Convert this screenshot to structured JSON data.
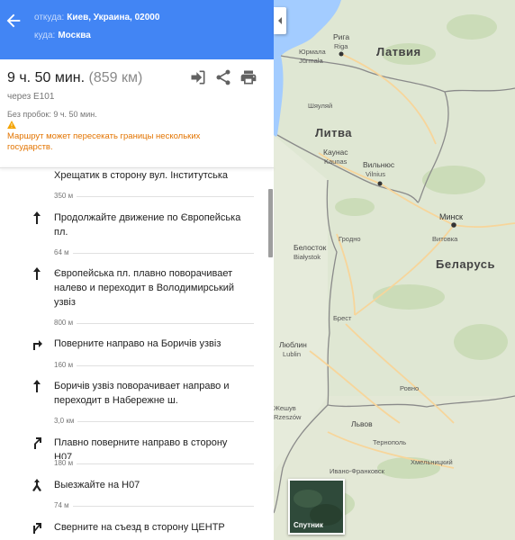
{
  "header": {
    "from_label": "откуда:",
    "from_value": "Киев, Украина, 02000",
    "to_label": "куда:",
    "to_value": "Москва"
  },
  "summary": {
    "duration": "9 ч. 50 мин.",
    "distance": "(859 км)",
    "via": "через E101",
    "no_traffic": "Без пробок: 9 ч. 50 мин.",
    "warning": "Маршрут может пересекать границы нескольких государств."
  },
  "steps": [
    {
      "text": "Хрещатик в сторону вул. Інститутська",
      "distance": "350 м",
      "icon": ""
    },
    {
      "text": "Продолжайте движение по Європейська пл.",
      "distance": "64 м",
      "icon": "straight-arrow-icon"
    },
    {
      "text": "Європейська пл. плавно поворачивает налево и переходит в Володимирський узвіз",
      "distance": "800 м",
      "icon": "straight-arrow-icon"
    },
    {
      "text": "Поверните направо на Боричів узвіз",
      "distance": "160 м",
      "icon": "turn-right-icon"
    },
    {
      "text": "Боричів узвіз поворачивает направо и переходит в Набережне ш.",
      "distance": "3,0 км",
      "icon": "straight-arrow-icon"
    },
    {
      "text": "Плавно поверните направо в сторону Н07",
      "distance": "180 м",
      "icon": "slight-right-icon"
    },
    {
      "text": "Выезжайте на Н07",
      "distance": "74 м",
      "icon": "merge-icon"
    },
    {
      "text": "Сверните на съезд в сторону ЦЕНТР",
      "distance": "",
      "icon": "ramp-right-icon"
    }
  ],
  "map": {
    "countries": {
      "latvia": "Латвия",
      "lithuania": "Литва",
      "belarus": "Беларусь"
    },
    "cities": {
      "riga_ru": "Рига",
      "riga": "Riga",
      "jurmala_ru": "Юрмала",
      "jurmala": "Jūrmala",
      "kaunas_ru": "Каунас",
      "kaunas": "Kaunas",
      "vilnius_ru": "Вильнюс",
      "vilnius": "Vilnius",
      "siauliai": "Шяуляй",
      "minsk": "Минск",
      "vitebsk": "Витовка",
      "grodno": "Гродно",
      "bialystok_ru": "Белосток",
      "bialystok": "Białystok",
      "brest": "Брест",
      "lublin_ru": "Люблин",
      "lublin": "Lublin",
      "rovno": "Ровно",
      "lvov": "Львов",
      "ternopol": "Тернополь",
      "khmelnitsky": "Хмельницкий",
      "ivano": "Ивано-Франковск",
      "rzeszow": "Жешув",
      "rzeszow2": "Rzeszów"
    },
    "satellite_label": "Спутник"
  },
  "colors": {
    "header": "#4285f4",
    "warning": "#e37400",
    "land": "#dfe7d3",
    "road": "#f7d59a",
    "border": "#8a8a8a"
  }
}
